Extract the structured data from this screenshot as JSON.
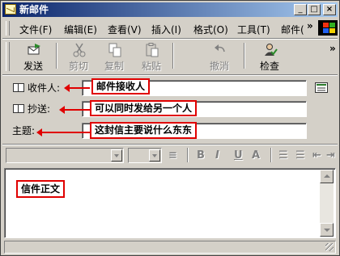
{
  "window": {
    "title": "新邮件",
    "cap_min": "_",
    "cap_max": "□",
    "cap_close": "×"
  },
  "menu": {
    "items": [
      "文件(F)",
      "编辑(E)",
      "查看(V)",
      "插入(I)",
      "格式(O)",
      "工具(T)",
      "邮件("
    ],
    "more": "»"
  },
  "toolbar": {
    "send": "发送",
    "cut": "剪切",
    "copy": "复制",
    "paste": "粘贴",
    "undo": "撤消",
    "check": "检查",
    "more": "»"
  },
  "header": {
    "to_label": "收件人:",
    "cc_label": "抄送:",
    "subject_label": "主题:"
  },
  "annotations": {
    "to_note": "邮件接收人",
    "cc_note": "可以同时发给另一个人",
    "subject_note": "这封信主要说什么东东",
    "body_note": "信件正文",
    "color": "#e00000"
  },
  "format": {
    "bold": "B",
    "italic": "I",
    "underline": "U",
    "fontcolor": "A"
  },
  "icons": [
    "mail-icon",
    "send-icon",
    "cut-icon",
    "copy-icon",
    "paste-icon",
    "undo-icon",
    "check-icon",
    "address-book-icon",
    "windows-logo-icon"
  ]
}
